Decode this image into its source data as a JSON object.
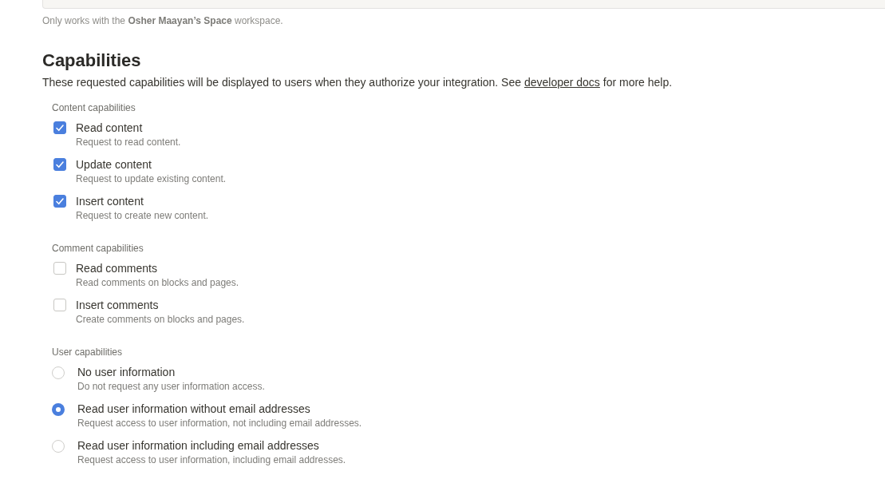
{
  "workspace_note": "Only works with the **Osher Maayan’s Space** workspace.",
  "capabilities": {
    "title": "Capabilities",
    "description_before": "These requested capabilities will be displayed to users when they authorize your integration. See",
    "description_link": "developer docs",
    "description_after": "for more help.",
    "groups": [
      {
        "label": "Content capabilities",
        "kind": "checkbox",
        "items": [
          {
            "name": "Read content",
            "description": "Request to read content.",
            "checked": true
          },
          {
            "name": "Update content",
            "description": "Request to update existing content.",
            "checked": true
          },
          {
            "name": "Insert content",
            "description": "Request to create new content.",
            "checked": true
          }
        ]
      },
      {
        "label": "Comment capabilities",
        "kind": "checkbox",
        "items": [
          {
            "name": "Read comments",
            "description": "Read comments on blocks and pages.",
            "checked": false
          },
          {
            "name": "Insert comments",
            "description": "Create comments on blocks and pages.",
            "checked": false
          }
        ]
      },
      {
        "label": "User capabilities",
        "kind": "radio",
        "items": [
          {
            "name": "No user information",
            "description": "Do not request any user information access.",
            "selected": false
          },
          {
            "name": "Read user information without email addresses",
            "description": "Request access to user information, not including email addresses.",
            "selected": true
          },
          {
            "name": "Read user information including email addresses",
            "description": "Request access to user information, including email addresses.",
            "selected": false
          }
        ]
      }
    ]
  }
}
